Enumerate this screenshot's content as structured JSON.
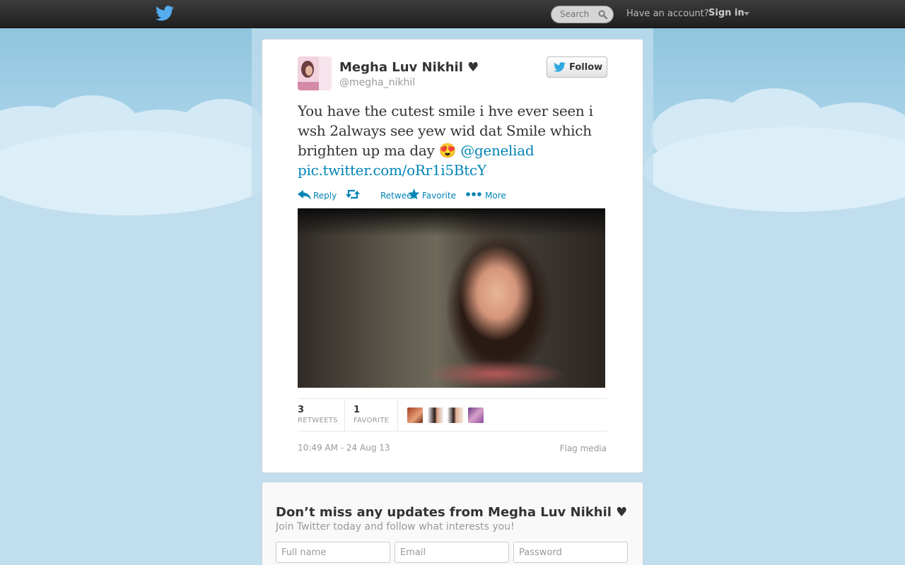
{
  "topbar": {
    "search_placeholder": "Search",
    "have_account": "Have an account?",
    "sign_in": "Sign in"
  },
  "tweet": {
    "fullname": "Megha Luv Nikhil ♥",
    "screen_name": "@megha_nikhil",
    "follow_label": "Follow",
    "text_line1": "You have the cutest smile i hve ever seen i",
    "text_line2": "wsh 2always see yew wid dat Smile which",
    "text_line3": "brighten up ma day  😍",
    "mention": "@geneliad",
    "pic_link": "pic.twitter.com/oRr1i5BtcY",
    "actions": {
      "reply": "Reply",
      "retweet": "Retweet",
      "favorite": "Favorite",
      "more": "More"
    },
    "stats": {
      "retweets_count": "3",
      "retweets_label": "RETWEETS",
      "favorites_count": "1",
      "favorites_label": "FAVORITE"
    },
    "timestamp": "10:49 AM - 24 Aug 13",
    "flag_media": "Flag media"
  },
  "signup": {
    "heading": "Don’t miss any updates from Megha Luv Nikhil ♥",
    "subheading": "Join Twitter today and follow what interests you!",
    "fullname_placeholder": "Full name",
    "email_placeholder": "Email",
    "password_placeholder": "Password"
  },
  "colors": {
    "link": "#0084b4",
    "topbar": "#2b2b2b",
    "background": "#c0deed"
  },
  "icons": [
    "twitter-bird-icon",
    "search-icon",
    "caret-down-icon",
    "reply-icon",
    "retweet-icon",
    "star-icon",
    "more-dots-icon"
  ]
}
